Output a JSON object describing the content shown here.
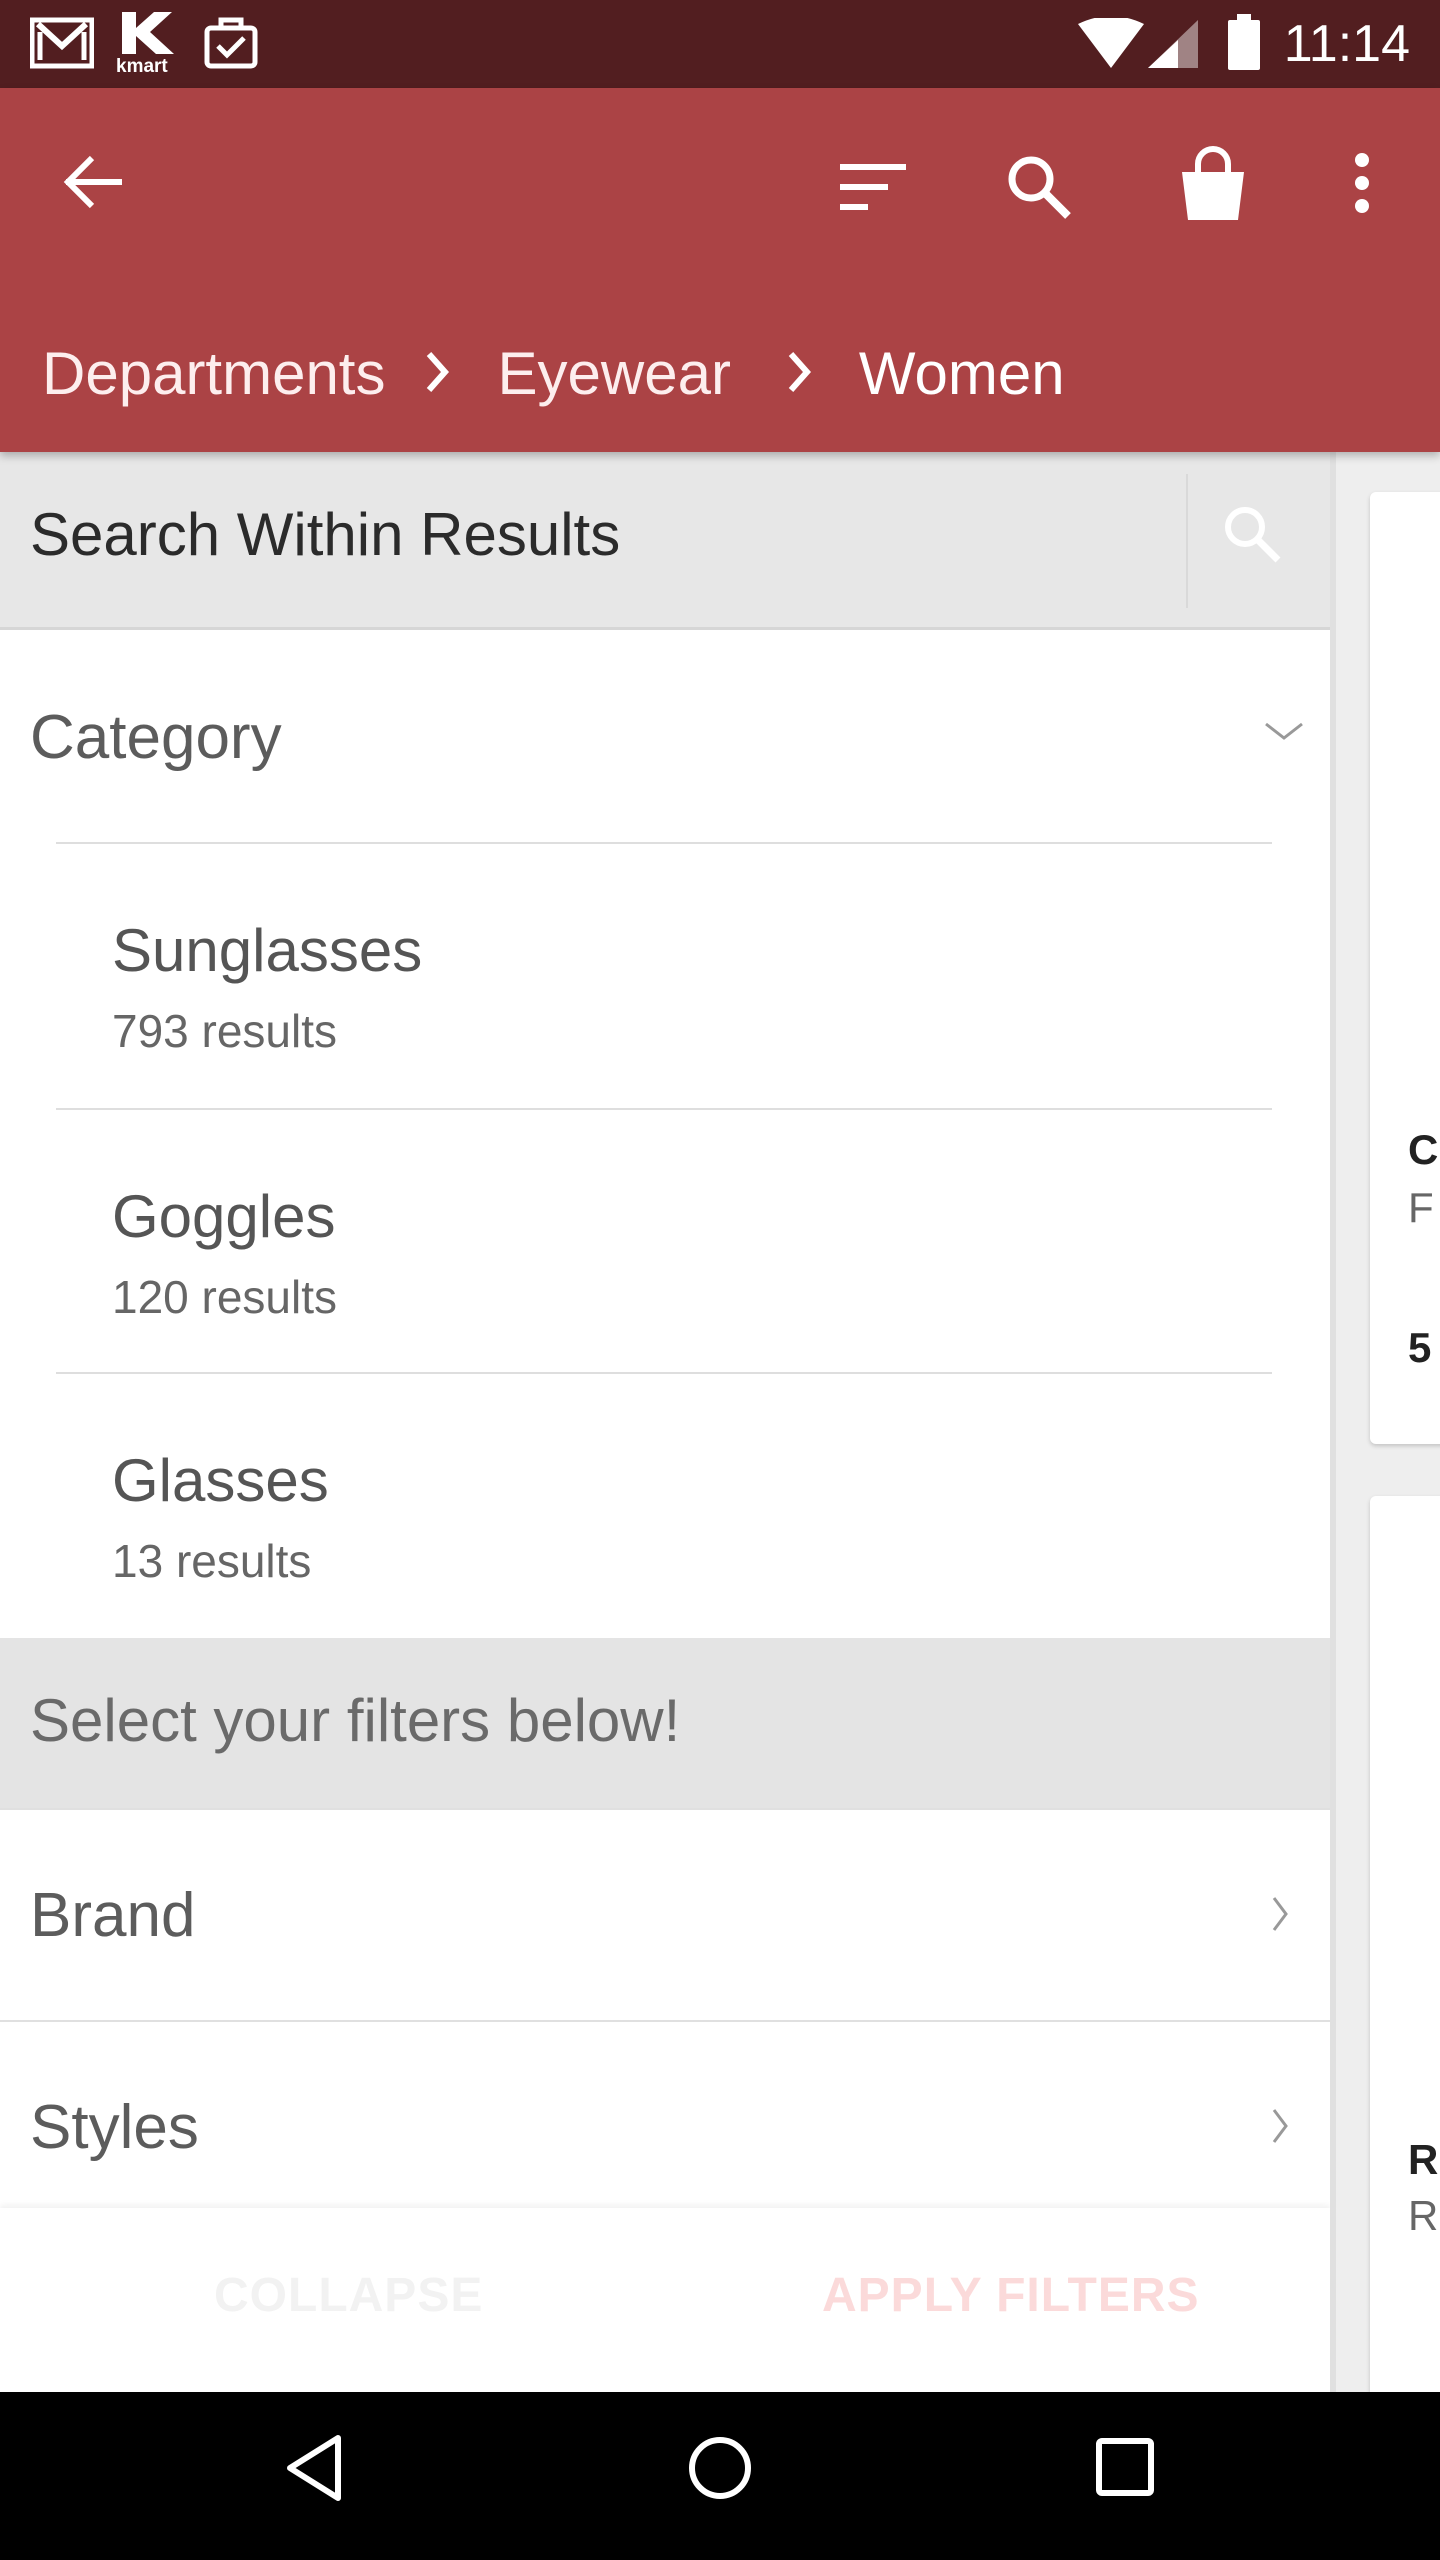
{
  "status_bar": {
    "time": "11:14",
    "left_icons": [
      "gmail-icon",
      "kmart-icon",
      "task-icon"
    ],
    "kmart_logo_text": "kmart",
    "right_icons": [
      "wifi-icon",
      "signal-icon",
      "battery-icon"
    ]
  },
  "app_bar": {
    "background": "#ab4345",
    "actions": [
      "back-arrow-icon",
      "sort-icon",
      "search-icon",
      "shopping-bag-icon",
      "more-vert-icon"
    ],
    "breadcrumb": {
      "items": [
        "Departments",
        "Eyewear",
        "Women"
      ]
    }
  },
  "search": {
    "placeholder": "Search Within Results"
  },
  "category": {
    "title": "Category",
    "items": [
      {
        "name": "Sunglasses",
        "count": "793 results"
      },
      {
        "name": "Goggles",
        "count": "120 results"
      },
      {
        "name": "Glasses",
        "count": "13 results"
      }
    ]
  },
  "filters": {
    "banner": "Select your filters below!",
    "rows": [
      {
        "label": "Brand"
      },
      {
        "label": "Styles"
      }
    ]
  },
  "actions": {
    "collapse": "COLLAPSE",
    "apply": "APPLY FILTERS"
  },
  "product_peek": {
    "card1": [
      "C",
      "F",
      "5"
    ],
    "card2": [
      "R",
      "R"
    ]
  },
  "nav_bar": {
    "buttons": [
      "back-triangle-icon",
      "home-circle-icon",
      "recents-square-icon"
    ]
  }
}
